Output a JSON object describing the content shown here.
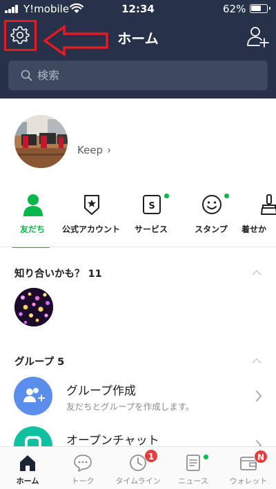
{
  "status_bar": {
    "carrier": "Y!mobile",
    "time": "12:34",
    "battery": "62%"
  },
  "header": {
    "title": "ホーム",
    "settings_icon": "gear-icon",
    "add_friend_icon": "add-friend-icon"
  },
  "search": {
    "placeholder": "検索"
  },
  "profile": {
    "keep_label": "Keep"
  },
  "categories": [
    {
      "label": "友だち",
      "icon": "person-icon",
      "active": true,
      "dot": false
    },
    {
      "label": "公式アカウント",
      "icon": "official-shield-icon",
      "active": false,
      "dot": false
    },
    {
      "label": "サービス",
      "icon": "services-icon",
      "active": false,
      "dot": true
    },
    {
      "label": "スタンプ",
      "icon": "sticker-smile-icon",
      "active": false,
      "dot": true
    },
    {
      "label": "着せか",
      "icon": "theme-brush-icon",
      "active": false,
      "dot": false
    }
  ],
  "sections": {
    "suggested": "知り合いかも？ 11",
    "groups": "グループ 5"
  },
  "group_rows": [
    {
      "title": "グループ作成",
      "subtitle": "友だちとグループを作成します。",
      "icon": "add-group-icon",
      "color": "#5b8ded"
    },
    {
      "title": "オープンチャット",
      "subtitle": "",
      "icon": "open-chat-icon",
      "color": "#0fc1a0"
    }
  ],
  "tabs": [
    {
      "label": "ホーム",
      "icon": "home-icon",
      "active": true
    },
    {
      "label": "トーク",
      "icon": "chat-bubble-icon",
      "active": false
    },
    {
      "label": "タイムライン",
      "icon": "clock-icon",
      "active": false,
      "badge": "1"
    },
    {
      "label": "ニュース",
      "icon": "news-icon",
      "active": false,
      "dot": true
    },
    {
      "label": "ウォレット",
      "icon": "wallet-icon",
      "active": false,
      "badge": "N"
    }
  ],
  "colors": {
    "header_bg": "#27324a",
    "accent_green": "#06b84b",
    "annotation_red": "#e51b24",
    "badge_red": "#e83b3b"
  }
}
